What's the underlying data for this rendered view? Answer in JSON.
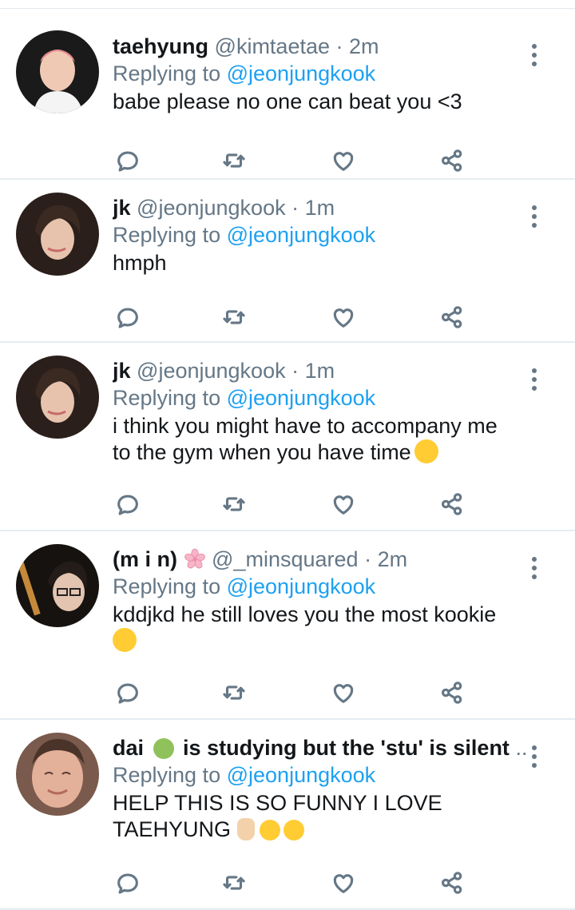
{
  "tweets": [
    {
      "name": "taehyung",
      "handle": "@kimtaetae",
      "time": "2m",
      "replying_label": "Replying to",
      "replying_to": "@jeonjungkook",
      "text": "babe please no one can beat you <3",
      "avatar_color": "#e8a0a0"
    },
    {
      "name": "jk",
      "handle": "@jeonjungkook",
      "time": "1m",
      "replying_label": "Replying to",
      "replying_to": "@jeonjungkook",
      "text": "hmph",
      "avatar_color": "#3a2b25"
    },
    {
      "name": "jk",
      "handle": "@jeonjungkook",
      "time": "1m",
      "replying_label": "Replying to",
      "replying_to": "@jeonjungkook",
      "text_line1": "i think you might have to accompany me",
      "text_line2": "to the gym when you have time",
      "emoji": "smiling-face-emoji",
      "avatar_color": "#3a2b25"
    },
    {
      "name": "(m i n)",
      "handle": "@_minsquared",
      "time": "2m",
      "replying_label": "Replying to",
      "replying_to": "@jeonjungkook",
      "text": "kddjkd he still loves you the most kookie",
      "emoji": "hand-over-mouth-emoji",
      "name_emoji": "cherry-blossom-icon",
      "avatar_color": "#1e1a17"
    },
    {
      "name_start": "dai",
      "name_end": "is studying but the 'stu' is silent",
      "name_ellipsis": "...",
      "name_emoji": "nauseated-face-emoji",
      "replying_label": "Replying to",
      "replying_to": "@jeonjungkook",
      "text_line1": "HELP THIS IS SO FUNNY I LOVE",
      "text_line2": "TAEHYUNG",
      "emojis": [
        "raised-hand-emoji",
        "loudly-crying-face-emoji",
        "loudly-crying-face-emoji"
      ],
      "avatar_color": "#c99a86"
    }
  ],
  "colors": {
    "link": "#1da1f2",
    "muted": "#657786",
    "text": "#14171a",
    "divider": "#e6ecf0"
  },
  "action_icons": [
    "reply-icon",
    "retweet-icon",
    "like-icon",
    "share-icon"
  ]
}
